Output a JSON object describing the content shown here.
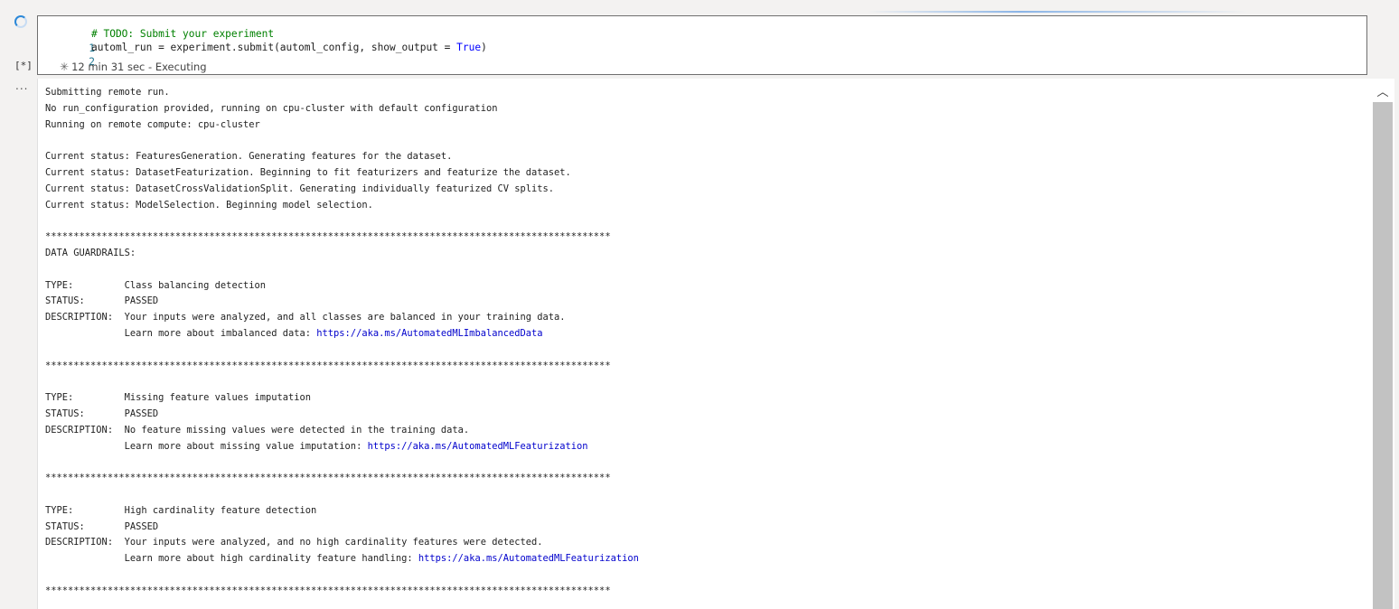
{
  "cell": {
    "execution_count": "[*]",
    "more_label": "...",
    "code_lines": [
      {
        "num": "1",
        "text": "# TODO: Submit your experiment"
      },
      {
        "num": "2",
        "pre": "automl_run = experiment.submit(automl_config, show_output = ",
        "kw": "True",
        "post": ")"
      }
    ],
    "status_icon": "running-asterisk-icon",
    "status_text": "12 min 31 sec - Executing"
  },
  "output": {
    "lines": [
      {
        "text": "Submitting remote run."
      },
      {
        "text": "No run_configuration provided, running on cpu-cluster with default configuration"
      },
      {
        "text": "Running on remote compute: cpu-cluster"
      },
      {
        "text": ""
      },
      {
        "text": "Current status: FeaturesGeneration. Generating features for the dataset."
      },
      {
        "text": "Current status: DatasetFeaturization. Beginning to fit featurizers and featurize the dataset."
      },
      {
        "text": "Current status: DatasetCrossValidationSplit. Generating individually featurized CV splits."
      },
      {
        "text": "Current status: ModelSelection. Beginning model selection."
      },
      {
        "text": ""
      },
      {
        "text": "****************************************************************************************************"
      },
      {
        "text": "DATA GUARDRAILS: "
      },
      {
        "text": ""
      },
      {
        "text": "TYPE:         Class balancing detection"
      },
      {
        "text": "STATUS:       PASSED"
      },
      {
        "text": "DESCRIPTION:  Your inputs were analyzed, and all classes are balanced in your training data."
      },
      {
        "text": "              Learn more about imbalanced data: ",
        "link": "https://aka.ms/AutomatedMLImbalancedData"
      },
      {
        "text": ""
      },
      {
        "text": "****************************************************************************************************"
      },
      {
        "text": ""
      },
      {
        "text": "TYPE:         Missing feature values imputation"
      },
      {
        "text": "STATUS:       PASSED"
      },
      {
        "text": "DESCRIPTION:  No feature missing values were detected in the training data."
      },
      {
        "text": "              Learn more about missing value imputation: ",
        "link": "https://aka.ms/AutomatedMLFeaturization"
      },
      {
        "text": ""
      },
      {
        "text": "****************************************************************************************************"
      },
      {
        "text": ""
      },
      {
        "text": "TYPE:         High cardinality feature detection"
      },
      {
        "text": "STATUS:       PASSED"
      },
      {
        "text": "DESCRIPTION:  Your inputs were analyzed, and no high cardinality features were detected."
      },
      {
        "text": "              Learn more about high cardinality feature handling: ",
        "link": "https://aka.ms/AutomatedMLFeaturization"
      },
      {
        "text": ""
      },
      {
        "text": "****************************************************************************************************"
      }
    ]
  },
  "scrollbar": {
    "up_icon": "chevron-up-icon"
  }
}
